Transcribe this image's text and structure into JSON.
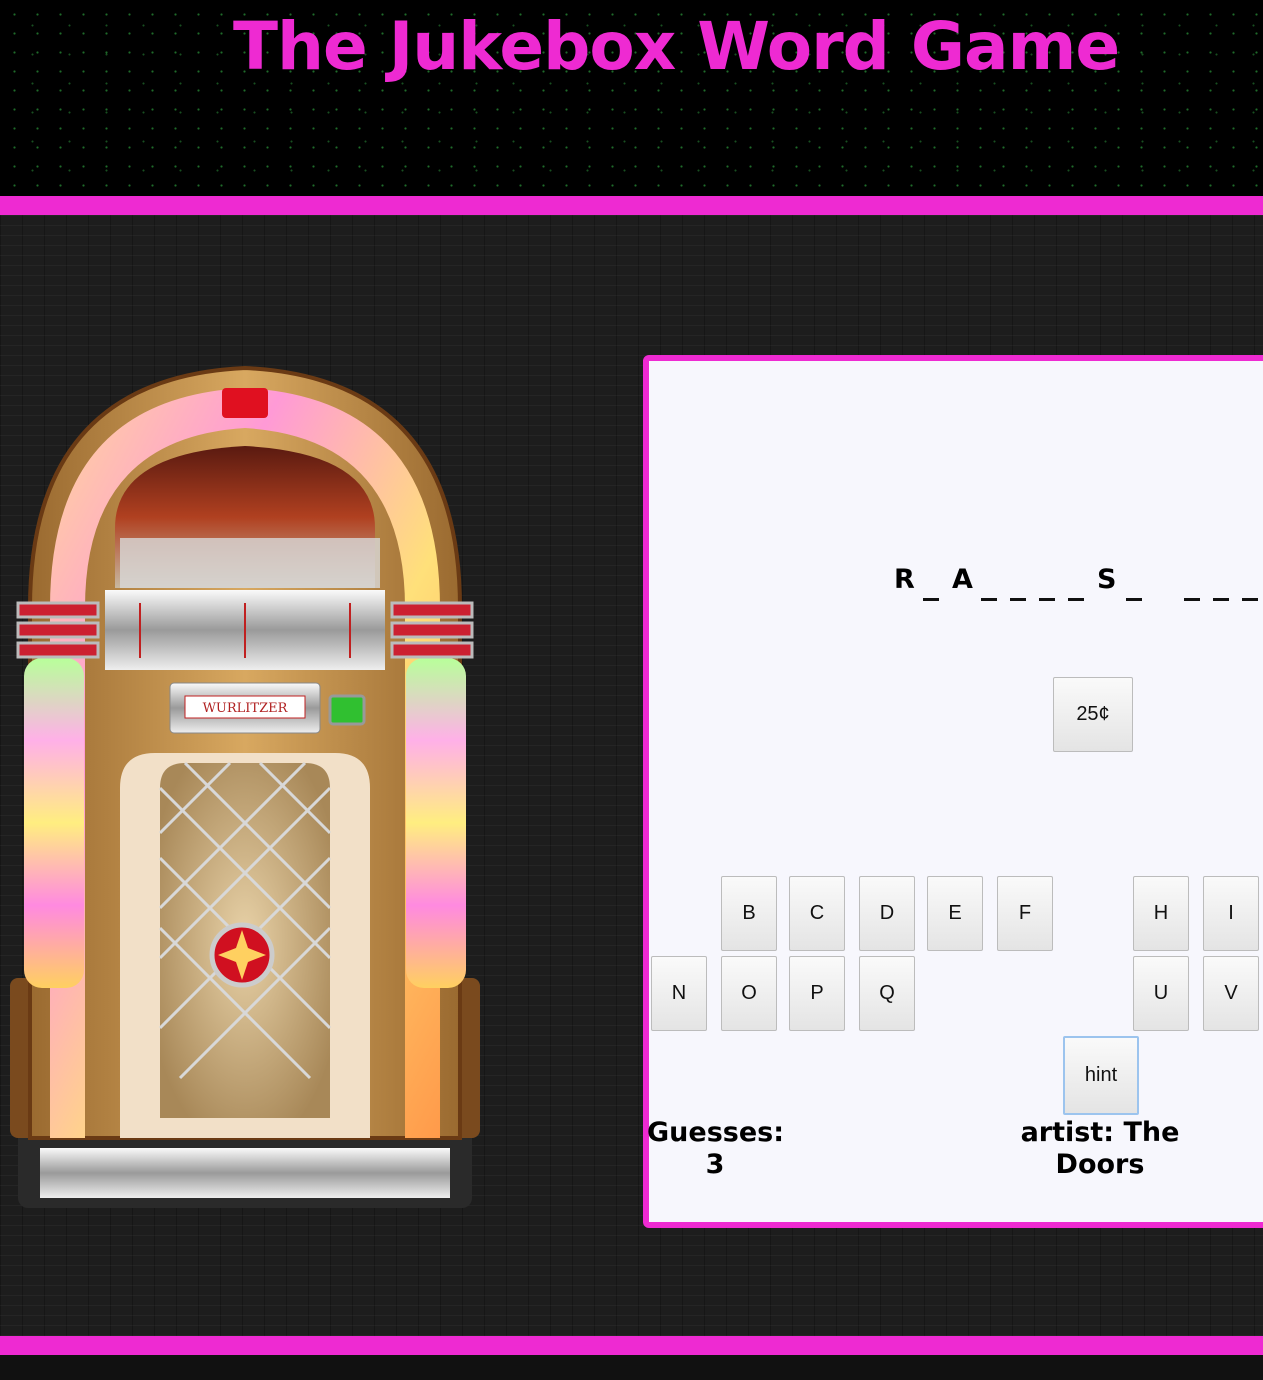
{
  "header": {
    "title": "The Jukebox Word Game"
  },
  "jukebox": {
    "brand": "Wurlitzer"
  },
  "puzzle": {
    "slots": [
      "R",
      "",
      "A",
      "",
      "",
      "",
      "",
      "S",
      "",
      " ",
      "",
      "",
      "",
      ""
    ]
  },
  "coin_button": {
    "label": "25¢"
  },
  "letters": [
    {
      "label": "B"
    },
    {
      "label": "C"
    },
    {
      "label": "D"
    },
    {
      "label": "E"
    },
    {
      "label": "F"
    },
    {
      "label": "H"
    },
    {
      "label": "I"
    },
    {
      "label": "N"
    },
    {
      "label": "O"
    },
    {
      "label": "P"
    },
    {
      "label": "Q"
    },
    {
      "label": "U"
    },
    {
      "label": "V"
    }
  ],
  "hint_button": {
    "label": "hint"
  },
  "status": {
    "guesses_label": "Guesses:",
    "guesses_value": "3",
    "artist_text": "artist: The Doors"
  },
  "colors": {
    "accent": "#ee2ad2",
    "background": "#1e1e1e",
    "panel": "#f7f7fd"
  }
}
